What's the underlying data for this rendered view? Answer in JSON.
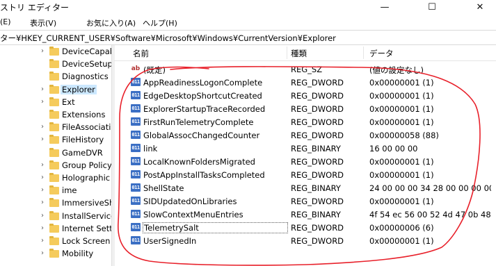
{
  "window": {
    "title": "ストリ エディター",
    "minimize_glyph": "—",
    "maximize_glyph": "☐",
    "close_glyph": "✕"
  },
  "menu": [
    "(E)",
    "表示(V)",
    "お気に入り(A)",
    "ヘルプ(H)"
  ],
  "address": "ター¥HKEY_CURRENT_USER¥Software¥Microsoft¥Windows¥CurrentVersion¥Explorer",
  "tree": [
    {
      "label": "DeviceCapab",
      "expandable": true
    },
    {
      "label": "DeviceSetup",
      "expandable": false
    },
    {
      "label": "Diagnostics",
      "expandable": false
    },
    {
      "label": "Explorer",
      "expandable": true,
      "selected": true
    },
    {
      "label": "Ext",
      "expandable": true
    },
    {
      "label": "Extensions",
      "expandable": false
    },
    {
      "label": "FileAssociatio",
      "expandable": true
    },
    {
      "label": "FileHistory",
      "expandable": true
    },
    {
      "label": "GameDVR",
      "expandable": false
    },
    {
      "label": "Group Policy",
      "expandable": true
    },
    {
      "label": "Holographic",
      "expandable": true
    },
    {
      "label": "ime",
      "expandable": true
    },
    {
      "label": "ImmersiveShe",
      "expandable": true
    },
    {
      "label": "InstallService",
      "expandable": true
    },
    {
      "label": "Internet Settin",
      "expandable": true
    },
    {
      "label": "Lock Screen",
      "expandable": true
    },
    {
      "label": "Mobility",
      "expandable": true
    }
  ],
  "columns": {
    "name": "名前",
    "type": "種類",
    "data": "データ"
  },
  "values": [
    {
      "name": "(既定)",
      "type": "REG_SZ",
      "data": "(値の設定なし)",
      "icon": "string-value-icon"
    },
    {
      "name": "AppReadinessLogonComplete",
      "type": "REG_DWORD",
      "data": "0x00000001 (1)",
      "icon": "binary-value-icon"
    },
    {
      "name": "EdgeDesktopShortcutCreated",
      "type": "REG_DWORD",
      "data": "0x00000001 (1)",
      "icon": "binary-value-icon"
    },
    {
      "name": "ExplorerStartupTraceRecorded",
      "type": "REG_DWORD",
      "data": "0x00000001 (1)",
      "icon": "binary-value-icon"
    },
    {
      "name": "FirstRunTelemetryComplete",
      "type": "REG_DWORD",
      "data": "0x00000001 (1)",
      "icon": "binary-value-icon"
    },
    {
      "name": "GlobalAssocChangedCounter",
      "type": "REG_DWORD",
      "data": "0x00000058 (88)",
      "icon": "binary-value-icon"
    },
    {
      "name": "link",
      "type": "REG_BINARY",
      "data": "16 00 00 00",
      "icon": "binary-value-icon"
    },
    {
      "name": "LocalKnownFoldersMigrated",
      "type": "REG_DWORD",
      "data": "0x00000001 (1)",
      "icon": "binary-value-icon"
    },
    {
      "name": "PostAppInstallTasksCompleted",
      "type": "REG_DWORD",
      "data": "0x00000001 (1)",
      "icon": "binary-value-icon"
    },
    {
      "name": "ShellState",
      "type": "REG_BINARY",
      "data": "24 00 00 00 34 28 00 00 00 00 0",
      "icon": "binary-value-icon"
    },
    {
      "name": "SIDUpdatedOnLibraries",
      "type": "REG_DWORD",
      "data": "0x00000001 (1)",
      "icon": "binary-value-icon"
    },
    {
      "name": "SlowContextMenuEntries",
      "type": "REG_BINARY",
      "data": "4f 54 ec 56 00 52 4d 47 0b 48 0",
      "icon": "binary-value-icon"
    },
    {
      "name": "TelemetrySalt",
      "type": "REG_DWORD",
      "data": "0x00000006 (6)",
      "icon": "binary-value-icon",
      "selected": true
    },
    {
      "name": "UserSignedIn",
      "type": "REG_DWORD",
      "data": "0x00000001 (1)",
      "icon": "binary-value-icon"
    }
  ],
  "annotation": {
    "color": "#e8202a"
  }
}
